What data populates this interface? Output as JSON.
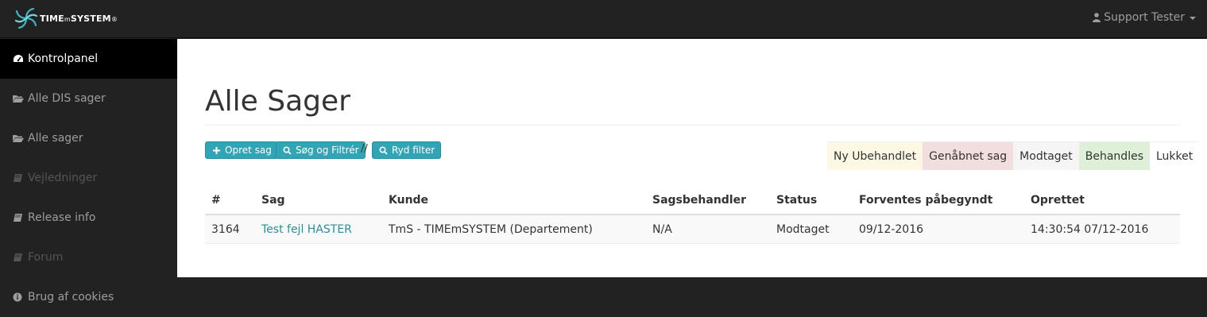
{
  "brand": {
    "name_part1": "TIME",
    "name_part2": "m",
    "name_part3": "SYSTEM",
    "registered": "®",
    "logo_icon": "swirl-logo-icon",
    "logo_color": "#3fb4bf"
  },
  "user_menu": {
    "label": "Support Tester",
    "icon": "user-icon"
  },
  "sidebar": {
    "items": [
      {
        "label": "Kontrolpanel",
        "icon": "dashboard-icon",
        "state": "active"
      },
      {
        "label": "Alle DIS sager",
        "icon": "folder-open-icon",
        "state": "normal"
      },
      {
        "label": "Alle sager",
        "icon": "folder-open-icon",
        "state": "normal"
      },
      {
        "label": "Vejledninger",
        "icon": "book-icon",
        "state": "disabled"
      },
      {
        "label": "Release info",
        "icon": "book-icon",
        "state": "normal"
      },
      {
        "label": "Forum",
        "icon": "book-icon",
        "state": "disabled"
      },
      {
        "label": "Brug af cookies",
        "icon": "info-icon",
        "state": "normal"
      }
    ]
  },
  "page": {
    "title": "Alle Sager",
    "buttons": {
      "create": "Opret sag",
      "search": "Søg og Filtrér",
      "separator": "//",
      "clear": "Ryd filter"
    },
    "legend": [
      {
        "label": "Ny Ubehandlet",
        "color": "#fcf8e3"
      },
      {
        "label": "Genåbnet sag",
        "color": "#f2dede"
      },
      {
        "label": "Modtaget",
        "color": "#f5f5f5"
      },
      {
        "label": "Behandles",
        "color": "#dff0d8"
      },
      {
        "label": "Lukket",
        "color": "#ffffff"
      }
    ],
    "accent": "#31a5b5"
  },
  "table": {
    "columns": [
      "#",
      "Sag",
      "Kunde",
      "Sagsbehandler",
      "Status",
      "Forventes påbegyndt",
      "Oprettet"
    ],
    "rows": [
      {
        "id": "3164",
        "sag": "Test fejl HASTER",
        "kunde": "TmS - TIMEmSYSTEM (Departement)",
        "sagsbehandler": "N/A",
        "status": "Modtaget",
        "forventes": "09/12-2016",
        "oprettet": "14:30:54 07/12-2016"
      }
    ]
  }
}
